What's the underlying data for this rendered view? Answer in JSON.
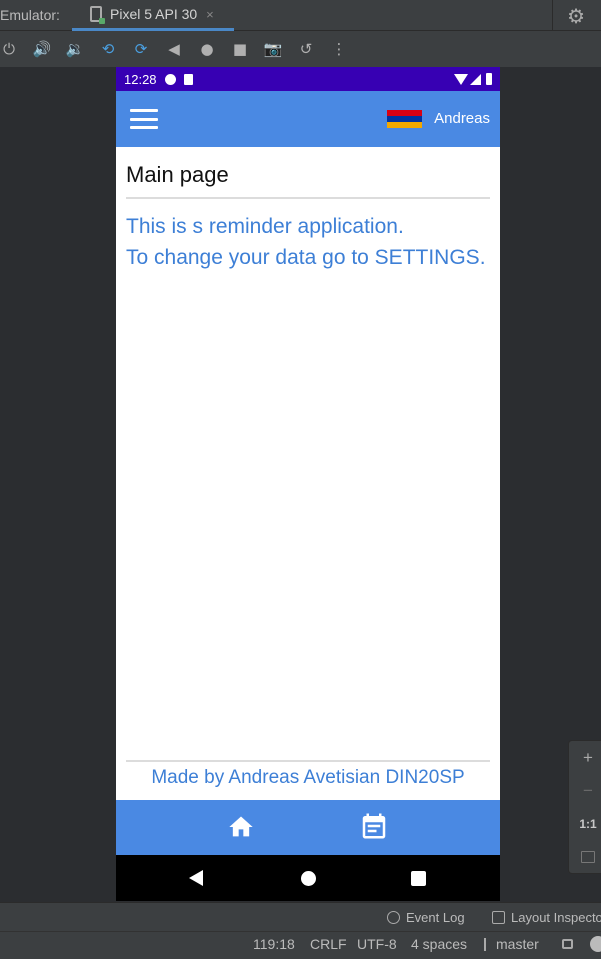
{
  "ide": {
    "emulator_label": "Emulator:",
    "device_tab": "Pixel 5 API 30",
    "close_glyph": "×",
    "gear_glyph": "⚙",
    "toolbar": [
      {
        "icon": "power-icon",
        "glyph": "⏻"
      },
      {
        "icon": "volume-up-icon",
        "glyph": "🔊"
      },
      {
        "icon": "volume-down-icon",
        "glyph": "🔉"
      },
      {
        "icon": "rotate-left-icon",
        "glyph": "⟲"
      },
      {
        "icon": "rotate-right-icon",
        "glyph": "⟳"
      },
      {
        "icon": "back-icon",
        "glyph": "◀"
      },
      {
        "icon": "home-icon",
        "glyph": "●"
      },
      {
        "icon": "overview-icon",
        "glyph": "■"
      },
      {
        "icon": "screenshot-icon",
        "glyph": "📷"
      },
      {
        "icon": "snapshot-icon",
        "glyph": "↺"
      },
      {
        "icon": "more-icon",
        "glyph": "⋮"
      }
    ],
    "zoom": {
      "plus": "+",
      "minus": "−",
      "one_to_one": "1:1"
    },
    "tool_windows": {
      "event_log": "Event Log",
      "layout_inspector": "Layout Inspector"
    },
    "status": {
      "position": "119:18",
      "line_sep": "CRLF",
      "encoding": "UTF-8",
      "indent": "4 spaces",
      "branch": "master"
    }
  },
  "phone": {
    "status": {
      "time": "12:28"
    },
    "appbar": {
      "username": "Andreas",
      "flag_colors": [
        "#d90012",
        "#0033a0",
        "#f2a800"
      ]
    },
    "page_title": "Main page",
    "intro_line1": "This is s reminder application.",
    "intro_line2": "To change your data go to SETTINGS.",
    "footer": "Made by Andreas Avetisian DIN20SP",
    "colors": {
      "primary": "#4a89e3",
      "status_bar": "#3700b3",
      "text_accent": "#3d7fd6"
    }
  }
}
